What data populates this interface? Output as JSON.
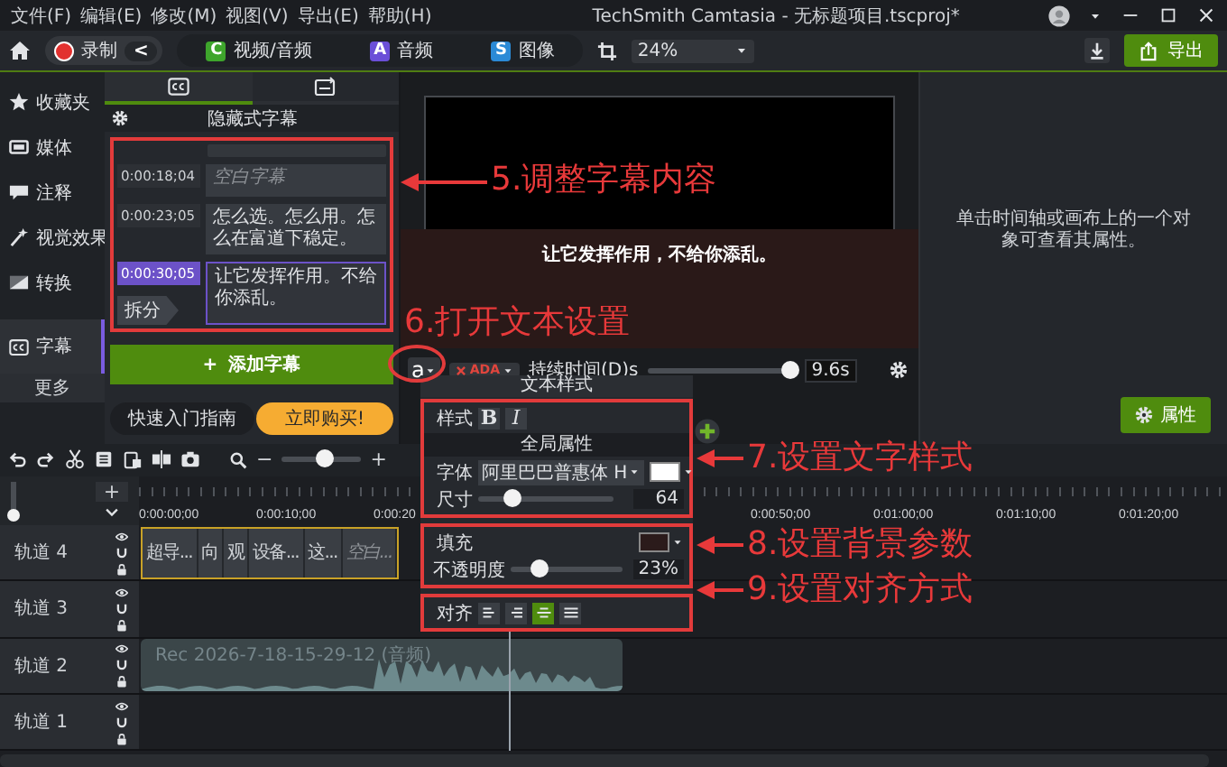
{
  "window": {
    "menu": [
      "文件(F)",
      "编辑(E)",
      "修改(M)",
      "视图(V)",
      "导出(E)",
      "帮助(H)"
    ],
    "title": "TechSmith Camtasia - 无标题项目.tscproj*"
  },
  "toolbar": {
    "record": "录制",
    "collapse": "<",
    "tabs": [
      {
        "letter": "C",
        "label": "视频/音频",
        "color": "#3ea52c"
      },
      {
        "letter": "A",
        "label": "音频",
        "color": "#6b4fd8"
      },
      {
        "letter": "S",
        "label": "图像",
        "color": "#2b8ad6"
      }
    ],
    "zoom": "24%",
    "export": "导出"
  },
  "sidebar": {
    "items": [
      {
        "label": "收藏夹",
        "selected": false
      },
      {
        "label": "媒体",
        "selected": false
      },
      {
        "label": "注释",
        "selected": false
      },
      {
        "label": "视觉效果",
        "selected": false
      },
      {
        "label": "转换",
        "selected": false
      },
      {
        "label": "字幕",
        "selected": true
      }
    ],
    "more": "更多"
  },
  "captions": {
    "tabs": [
      {
        "selected": true
      },
      {
        "selected": false
      }
    ],
    "title": "隐藏式字幕",
    "entries": [
      {
        "time": "0:00:18;04",
        "text": "空白字幕",
        "blank": true,
        "selected": false
      },
      {
        "time": "0:00:23;05",
        "text": "怎么选。怎么用。怎么在富道下稳定。",
        "blank": false,
        "selected": false
      },
      {
        "time": "0:00:30;05",
        "text": "让它发挥作用。不给你添乱。",
        "blank": false,
        "selected": true,
        "split": "拆分"
      }
    ],
    "add": {
      "icon": "+",
      "label": "添加字幕"
    },
    "guide": "快速入门指南",
    "buy": "立即购买!"
  },
  "canvas": {
    "caption": "让它发挥作用，不给你添乱。",
    "style_button": "a",
    "ada": "ADA",
    "duration": {
      "label": "持续时间(D)s",
      "level": 0.97,
      "value": "9.6s"
    }
  },
  "text_style": {
    "title": "文本样式",
    "style_label": "样式",
    "bold": "B",
    "italic": "I",
    "global": "全局属性",
    "font_label": "字体",
    "font": "阿里巴巴普惠体 H",
    "font_swatch": {
      "color": "#ffffff"
    },
    "size_label": "尺寸",
    "size": {
      "level": 0.25,
      "value": "64"
    },
    "fill_label": "填充",
    "fill_swatch": {
      "color": "#2b1b1b"
    },
    "opacity": {
      "label": "不透明度",
      "level": 0.25,
      "value": "23%"
    },
    "align_label": "对齐",
    "align": [
      {
        "kind": "left",
        "selected": false
      },
      {
        "kind": "right",
        "selected": false
      },
      {
        "kind": "center",
        "selected": true
      },
      {
        "kind": "justify",
        "selected": false
      }
    ]
  },
  "properties": {
    "hint": "单击时间轴或画布上的一个对象可查看其属性。",
    "button": "属性"
  },
  "timeline": {
    "zoom_out": "−",
    "zoom": {
      "level": 0.55
    },
    "zoom_in": "+",
    "track_height": {
      "level": 0.05
    },
    "add_track": "+",
    "ruler_start": [
      "0:00:00;00",
      "0:00:10;00",
      "0:00:20"
    ],
    "ruler_end": [
      "0:00:50;00",
      "0:01:00;00",
      "0:01:10;00",
      "0:01:20;00"
    ],
    "tracks": [
      {
        "name": "轨道 4",
        "kind": "captions",
        "selected": true,
        "clips": [
          {
            "text": "超导...",
            "blank": false
          },
          {
            "text": "向",
            "blank": false
          },
          {
            "text": "观",
            "blank": false
          },
          {
            "text": "设备...",
            "blank": false
          },
          {
            "text": "这...",
            "blank": false
          },
          {
            "text": "空白...",
            "blank": true
          }
        ]
      },
      {
        "name": "轨道 3",
        "kind": "empty"
      },
      {
        "name": "轨道 2",
        "kind": "audio",
        "selected": false,
        "clip": "Rec 2026-7-18-15-29-12 (音频)"
      },
      {
        "name": "轨道 1",
        "kind": "empty"
      }
    ]
  },
  "annotations": [
    {
      "text": "5.调整字幕内容",
      "arrow": true
    },
    {
      "text": "6.打开文本设置",
      "arrow": false
    },
    {
      "text": "7.设置文字样式",
      "arrow": true
    },
    {
      "text": "8.设置背景参数",
      "arrow": true
    },
    {
      "text": "9.设置对齐方式",
      "arrow": true
    }
  ]
}
